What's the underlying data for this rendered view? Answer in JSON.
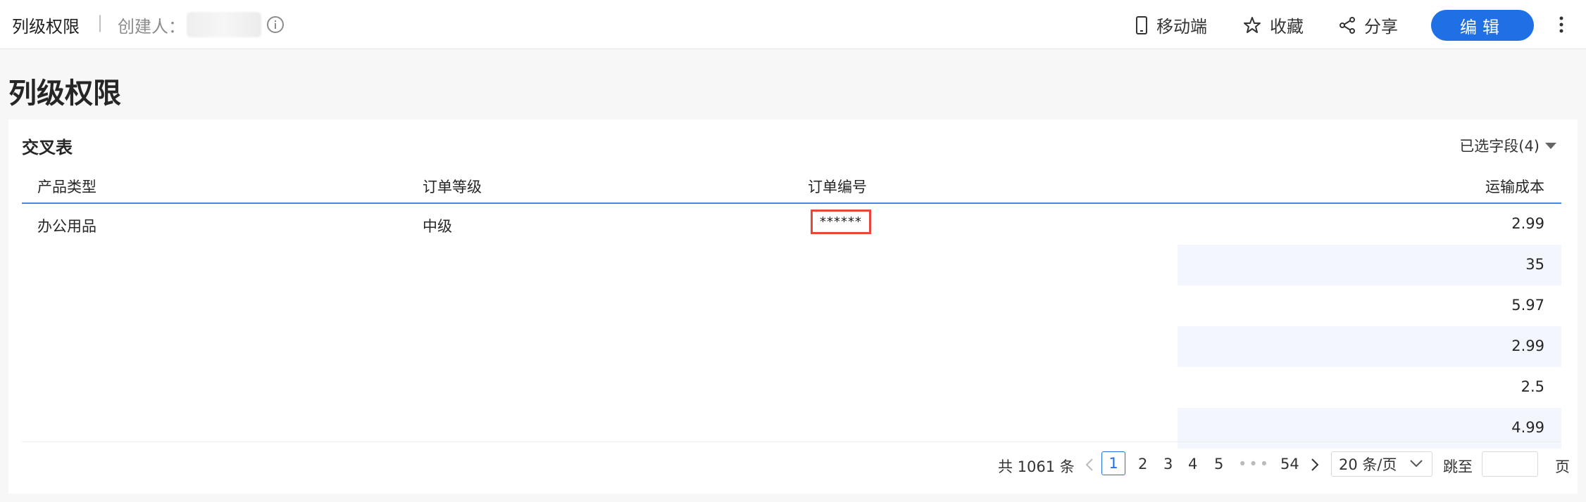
{
  "header": {
    "title": "列级权限",
    "separator": "|",
    "creator_label": "创建人：",
    "actions": {
      "mobile": "移动端",
      "favorite": "收藏",
      "share": "分享",
      "edit": "编辑"
    }
  },
  "page": {
    "title": "列级权限"
  },
  "card": {
    "title": "交叉表",
    "field_select": "已选字段(4)"
  },
  "table": {
    "columns": [
      "产品类型",
      "订单等级",
      "订单编号",
      "运输成本"
    ],
    "rows": [
      {
        "product_type": "办公用品",
        "order_level": "中级",
        "order_id": "******",
        "shipping_cost": "2.99"
      },
      {
        "product_type": "",
        "order_level": "",
        "order_id": "",
        "shipping_cost": "35"
      },
      {
        "product_type": "",
        "order_level": "",
        "order_id": "",
        "shipping_cost": "5.97"
      },
      {
        "product_type": "",
        "order_level": "",
        "order_id": "",
        "shipping_cost": "2.99"
      },
      {
        "product_type": "",
        "order_level": "",
        "order_id": "",
        "shipping_cost": "2.5"
      },
      {
        "product_type": "",
        "order_level": "",
        "order_id": "",
        "shipping_cost": "4.99"
      }
    ]
  },
  "pagination": {
    "total": "共 1061 条",
    "prev": "<",
    "pages": [
      "1",
      "2",
      "3",
      "4",
      "5"
    ],
    "dots": "•••",
    "last": "54",
    "next": ">",
    "page_size": "20 条/页",
    "jump_label": "跳至",
    "page_label": "页"
  },
  "colors": {
    "accent": "#1f6fe5",
    "mask_border": "#e5473b",
    "stripe": "#f3f6fd"
  },
  "icons": [
    "info-icon",
    "mobile-icon",
    "star-icon",
    "share-icon",
    "more-icon",
    "caret-down-icon",
    "chevron-down-icon"
  ]
}
